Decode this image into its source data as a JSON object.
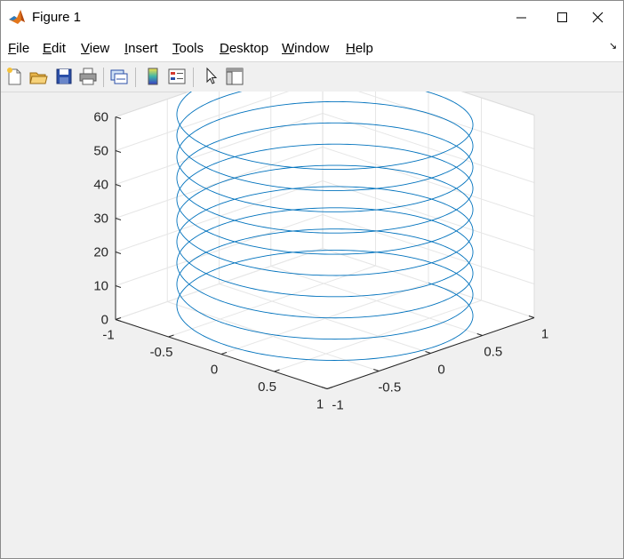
{
  "window": {
    "title": "Figure 1"
  },
  "menu": {
    "items": [
      {
        "ul": "F",
        "rest": "ile"
      },
      {
        "ul": "E",
        "rest": "dit"
      },
      {
        "ul": "V",
        "rest": "iew"
      },
      {
        "ul": "I",
        "rest": "nsert"
      },
      {
        "ul": "T",
        "rest": "ools"
      },
      {
        "ul": "D",
        "rest": "esktop"
      },
      {
        "ul": "W",
        "rest": "indow"
      },
      {
        "ul": "H",
        "rest": "elp"
      }
    ]
  },
  "toolbar": {
    "buttons": [
      "new-figure-icon",
      "open-file-icon",
      "save-icon",
      "print-icon",
      "link-plot-icon",
      "colorbar-icon",
      "legend-icon",
      "edit-plot-arrow-icon",
      "property-inspector-icon"
    ]
  },
  "chart_data": {
    "type": "line",
    "plot": "plot3",
    "series": [
      {
        "function": "x = sin(t), y = cos(t), z = t",
        "t_range": [
          0,
          62.8
        ],
        "color": "#0072bd"
      }
    ],
    "x_ticks": [
      "-1",
      "-0.5",
      "0",
      "0.5",
      "1"
    ],
    "y_ticks": [
      "-1",
      "-0.5",
      "0",
      "0.5",
      "1"
    ],
    "z_ticks": [
      "0",
      "10",
      "20",
      "30",
      "40",
      "50",
      "60"
    ],
    "xlim": [
      -1,
      1
    ],
    "ylim": [
      -1,
      1
    ],
    "zlim": [
      0,
      60
    ],
    "grid": true,
    "view": "3-D default (az -37.5, el 30)"
  }
}
